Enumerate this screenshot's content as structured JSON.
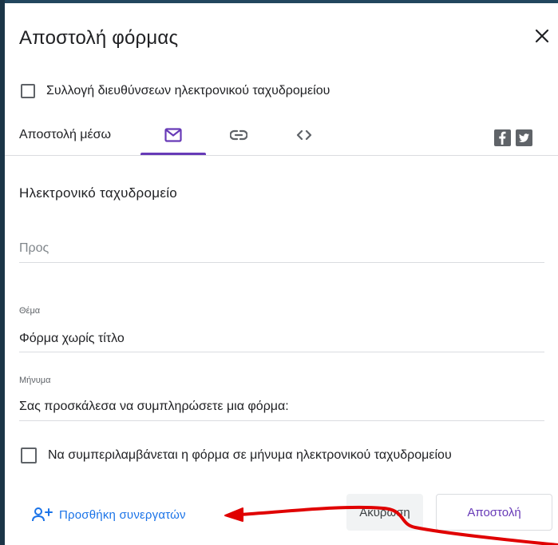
{
  "dialog": {
    "title": "Αποστολή φόρμας",
    "collect_emails_label": "Συλλογή διευθύνσεων ηλεκτρονικού ταχυδρομείου",
    "send_via_label": "Αποστολή μέσω",
    "tabs": [
      {
        "icon": "mail-icon",
        "active": true
      },
      {
        "icon": "link-icon",
        "active": false
      },
      {
        "icon": "embed-code-icon",
        "active": false
      }
    ],
    "social": [
      "facebook-icon",
      "twitter-icon"
    ],
    "accent_color": "#673ab7"
  },
  "email": {
    "section_title": "Ηλεκτρονικό ταχυδρομείο",
    "to_placeholder": "Προς",
    "subject_label": "Θέμα",
    "subject_value": "Φόρμα χωρίς τίτλο",
    "message_label": "Μήνυμα",
    "message_value": "Σας προσκάλεσα να συμπληρώσετε μια φόρμα:",
    "include_form_label": "Να συμπεριλαμβάνεται η φόρμα σε μήνυμα ηλεκτρονικού ταχυδρομείου"
  },
  "footer": {
    "add_collaborators_label": "Προσθήκη συνεργατών",
    "cancel_label": "Ακύρωση",
    "send_label": "Αποστολή",
    "link_color": "#1a73e8"
  },
  "annotation": {
    "arrow_color": "#e00000"
  }
}
